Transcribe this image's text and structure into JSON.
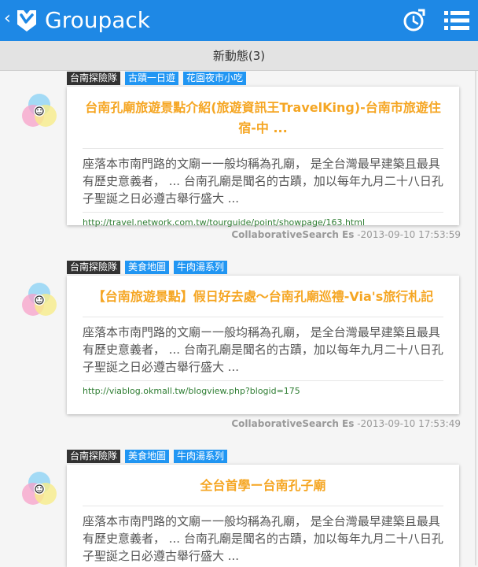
{
  "header": {
    "back_icon": "chevron-left-icon",
    "title": "Groupack"
  },
  "subheader": {
    "title": "新動態(3)"
  },
  "posts": [
    {
      "tags": [
        "台南探險隊",
        "古蹟一日遊",
        "花園夜市小吃"
      ],
      "title": "台南孔廟旅遊景點介紹(旅遊資訊王TravelKing)-台南市旅遊住宿-中 ...",
      "snippet": "座落本市南門路的文廟ー一般均稱為孔廟， 是全台灣最早建築且最具有歷史意義者， ... 台南孔廟是聞名的古蹟，加以每年九月二十八日孔子聖誕之日必遵古舉行盛大 ...",
      "url": "http://travel.network.com.tw/tourguide/point/showpage/163.html",
      "author": "CollaborativeSearch Es",
      "timestamp": "-2013-09-10 17:53:59"
    },
    {
      "tags": [
        "台南探險隊",
        "美食地圖",
        "牛肉湯系列"
      ],
      "title": "【台南旅遊景點】假日好去處～台南孔廟巡禮-Via's旅行札記",
      "snippet": "座落本市南門路的文廟ー一般均稱為孔廟， 是全台灣最早建築且最具有歷史意義者， ... 台南孔廟是聞名的古蹟，加以每年九月二十八日孔子聖誕之日必遵古舉行盛大 ...",
      "url": "http://viablog.okmall.tw/blogview.php?blogid=175",
      "author": "CollaborativeSearch Es",
      "timestamp": "-2013-09-10 17:53:49"
    },
    {
      "tags": [
        "台南探險隊",
        "美食地圖",
        "牛肉湯系列"
      ],
      "title": "全台首學ー台南孔子廟",
      "snippet": "座落本市南門路的文廟ー一般均稱為孔廟， 是全台灣最早建築且最具有歷史意義者， ... 台南孔廟是聞名的古蹟，加以每年九月二十八日孔子聖誕之日必遵古舉行盛大 ..."
    }
  ],
  "colors": {
    "header_bg": "#1e88e5",
    "title_accent": "#f5a623",
    "tag_dark": "#333333",
    "tag_blue": "#2196f3",
    "url_green": "#2e7d32"
  }
}
